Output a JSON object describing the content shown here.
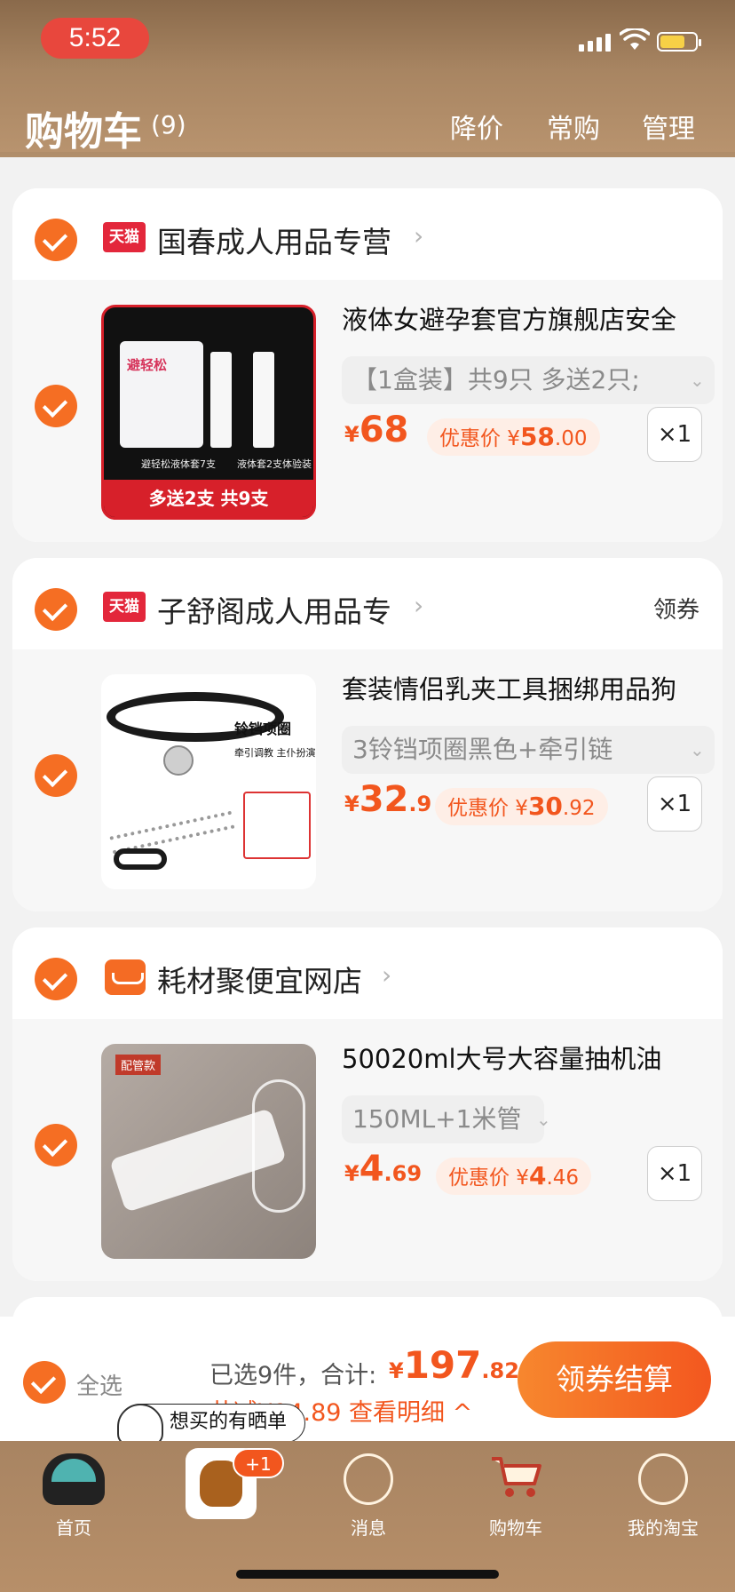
{
  "status_bar": {
    "time": "5:52"
  },
  "header": {
    "title": "购物车",
    "count": "(9)",
    "actions": [
      "降价",
      "常购",
      "管理"
    ]
  },
  "shops": [
    {
      "badge": "天猫",
      "name": "国春成人用品专营",
      "coupon": "",
      "item": {
        "title": "液体女避孕套官方旗舰店安全",
        "sku": "【1盒装】共9只 多送2只;",
        "price_yen": "¥",
        "price_int": "68",
        "price_dec": "",
        "discount_label": "优惠价",
        "discount_int": "58",
        "discount_dec": ".00",
        "qty": "×1",
        "thumb_banner": "多送2支 共9支",
        "thumb_brand": "避轻松",
        "thumb_cap_left": "避轻松液体套7支",
        "thumb_cap_right": "液体套2支体验装"
      }
    },
    {
      "badge": "天猫",
      "name": "子舒阁成人用品专",
      "coupon": "领券",
      "item": {
        "title": "套装情侣乳夹工具捆绑用品狗",
        "sku": "3铃铛项圈黑色+牵引链",
        "price_yen": "¥",
        "price_int": "32",
        "price_dec": ".9",
        "discount_label": "优惠价",
        "discount_int": "30",
        "discount_dec": ".92",
        "qty": "×1",
        "thumb_caption1": "铃铛项圈",
        "thumb_caption2": "牵引调教 主仆扮演"
      }
    },
    {
      "badge": "",
      "name": "耗材聚便宜网店",
      "coupon": "",
      "item": {
        "title": "50020ml大号大容量抽机油",
        "sku": "150ML+1米管",
        "price_yen": "¥",
        "price_int": "4",
        "price_dec": ".69",
        "discount_label": "优惠价",
        "discount_int": "4",
        "discount_dec": ".46",
        "qty": "×1",
        "thumb_tag": "配管款"
      }
    }
  ],
  "footer": {
    "select_all": "全选",
    "selected_text": "已选9件，合计:",
    "total_yen": "¥",
    "total_int": "197",
    "total_dec": ".82",
    "saved_text": "共减¥14.89 查看明细 ^",
    "checkout": "领券结算",
    "bubble": "想买的有晒单"
  },
  "tabbar": {
    "items": [
      "首页",
      "",
      "消息",
      "购物车",
      "我的淘宝"
    ],
    "badge": "+1"
  },
  "colors": {
    "accent": "#f2561e",
    "check": "#f56e23",
    "tmall": "#e3273b",
    "header": "#a88562"
  }
}
